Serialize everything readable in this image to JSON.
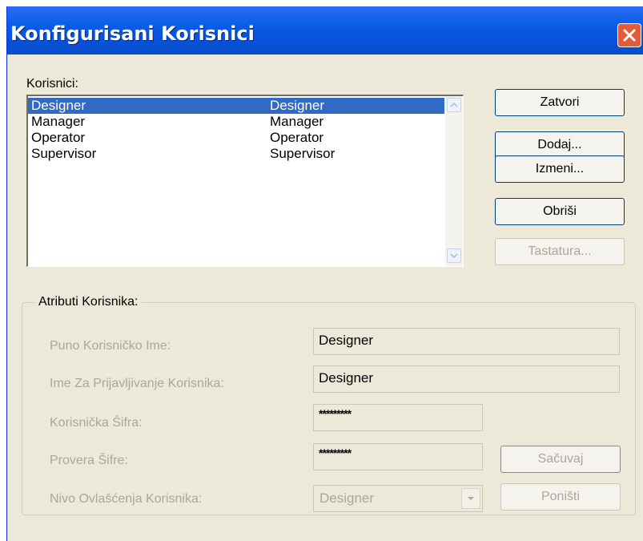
{
  "window": {
    "title": "Konfigurisani Korisnici"
  },
  "users": {
    "label": "Korisnici:",
    "items": [
      {
        "name": "Designer",
        "level": "Designer",
        "selected": true
      },
      {
        "name": "Manager",
        "level": "Manager",
        "selected": false
      },
      {
        "name": "Operator",
        "level": "Operator",
        "selected": false
      },
      {
        "name": "Supervisor",
        "level": "Supervisor",
        "selected": false
      }
    ]
  },
  "buttons": {
    "close": "Zatvori",
    "add": "Dodaj...",
    "edit": "Izmeni...",
    "delete": "Obriši",
    "keyboard": "Tastatura..."
  },
  "attributes": {
    "legend": "Atributi Korisnika:",
    "full_name_label": "Puno Korisničko Ime:",
    "full_name_value": "Designer",
    "login_label": "Ime Za Prijavljivanje Korisnika:",
    "login_value": "Designer",
    "password_label": "Korisnička Šifra:",
    "password_value": "*********",
    "confirm_label": "Provera Šifre:",
    "confirm_value": "*********",
    "level_label": "Nivo Ovlašćenja Korisnika:",
    "level_value": "Designer",
    "save": "Sačuvaj",
    "cancel": "Poništi"
  },
  "colors": {
    "selection": "#316ac5",
    "title_bar": "#0a5ce8",
    "dialog_bg": "#ece9d8",
    "disabled_text": "#aca899"
  },
  "icons": [
    "close-icon",
    "scroll-up-icon",
    "scroll-down-icon",
    "dropdown-arrow-icon"
  ]
}
